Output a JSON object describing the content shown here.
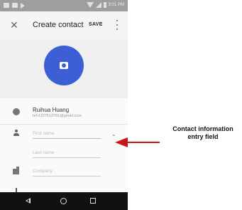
{
  "status_bar": {
    "time": "3:01 PM"
  },
  "app_bar": {
    "title": "Create contact",
    "save_label": "SAVE",
    "close_icon": "close-icon",
    "more_icon": "more-vert-icon"
  },
  "photo": {
    "icon": "camera-icon",
    "color": "#3d5fd6"
  },
  "account": {
    "name": "Ruihua Huang",
    "email": "hrh1157513791@gmail.com"
  },
  "fields": {
    "first_name_placeholder": "First name",
    "last_name_placeholder": "Last name",
    "company_placeholder": "Company"
  },
  "annotation": {
    "text": "Contact information entry field",
    "arrow_color": "#c81818"
  }
}
